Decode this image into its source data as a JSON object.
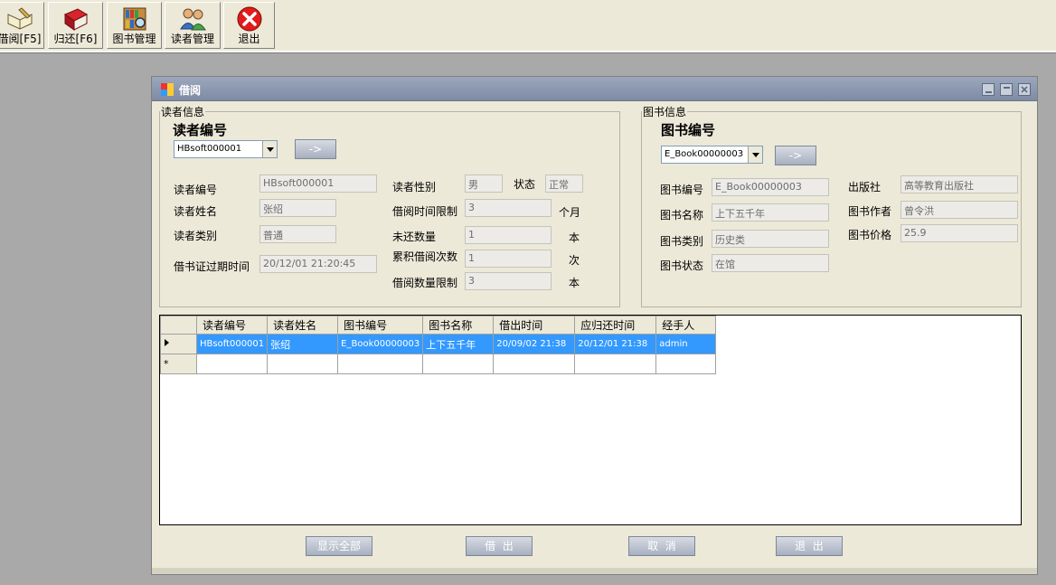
{
  "toolbar": {
    "buttons": [
      {
        "label": "借阅[F5]",
        "icon": "book-pen-icon"
      },
      {
        "label": "归还[F6]",
        "icon": "red-book-icon"
      },
      {
        "label": "图书管理",
        "icon": "bookshelf-search-icon"
      },
      {
        "label": "读者管理",
        "icon": "users-icon"
      },
      {
        "label": "退出",
        "icon": "close-icon"
      }
    ]
  },
  "window": {
    "title": "借阅"
  },
  "reader": {
    "legend": "读者信息",
    "heading": "读者编号",
    "combo_value": "HBsoft000001",
    "go_label": "->",
    "fields": {
      "id_label": "读者编号",
      "id_value": "HBsoft000001",
      "name_label": "读者姓名",
      "name_value": "张绍",
      "type_label": "读者类别",
      "type_value": "普通",
      "expire_label": "借书证过期时间",
      "expire_value": "20/12/01 21:20:45",
      "gender_label": "读者性别",
      "gender_value": "男",
      "status_label": "状态",
      "status_value": "正常",
      "limit_time_label": "借阅时间限制",
      "limit_time_value": "3",
      "limit_time_unit": "个月",
      "unreturned_label": "未还数量",
      "unreturned_value": "1",
      "unreturned_unit": "本",
      "total_label": "累积借阅次数",
      "total_value": "1",
      "total_unit": "次",
      "limit_count_label": "借阅数量限制",
      "limit_count_value": "3",
      "limit_count_unit": "本"
    }
  },
  "book": {
    "legend": "图书信息",
    "heading": "图书编号",
    "combo_value": "E_Book00000003",
    "go_label": "->",
    "fields": {
      "id_label": "图书编号",
      "id_value": "E_Book00000003",
      "name_label": "图书名称",
      "name_value": "上下五千年",
      "type_label": "图书类别",
      "type_value": "历史类",
      "state_label": "图书状态",
      "state_value": "在馆",
      "publisher_label": "出版社",
      "publisher_value": "高等教育出版社",
      "author_label": "图书作者",
      "author_value": "曾令洪",
      "price_label": "图书价格",
      "price_value": "25.9"
    }
  },
  "grid": {
    "columns": [
      "读者编号",
      "读者姓名",
      "图书编号",
      "图书名称",
      "借出时间",
      "应归还时间",
      "经手人"
    ],
    "rows": [
      [
        "HBsoft000001",
        "张绍",
        "E_Book00000003",
        "上下五千年",
        "20/09/02 21:38",
        "20/12/01 21:38",
        "admin"
      ]
    ],
    "new_row_marker": "*"
  },
  "actions": {
    "show_all": "显示全部",
    "borrow": "借  出",
    "cancel": "取  消",
    "exit": "退  出"
  }
}
